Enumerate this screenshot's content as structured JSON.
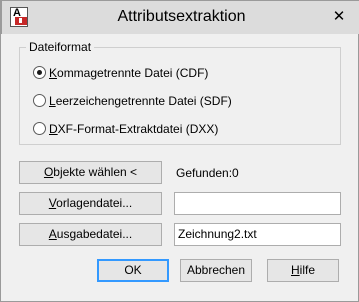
{
  "window": {
    "title": "Attributsextraktion",
    "close_glyph": "✕",
    "icon_letter": "A"
  },
  "dateiformat": {
    "group_label": "Dateiformat",
    "options": [
      {
        "accel": "K",
        "rest": "ommagetrennte Datei (CDF)",
        "selected": true
      },
      {
        "accel": "L",
        "rest": "eerzeichengetrennte Datei (SDF)",
        "selected": false
      },
      {
        "accel": "D",
        "rest": "XF-Format-Extraktdatei (DXX)",
        "selected": false
      }
    ]
  },
  "objects": {
    "button_accel": "O",
    "button_rest": "bjekte wählen <",
    "found_label": "Gefunden:",
    "found_value": "0"
  },
  "vorlage": {
    "button_accel": "V",
    "button_rest": "orlagendatei...",
    "value": ""
  },
  "ausgabe": {
    "button_accel": "A",
    "button_rest": "usgabedatei...",
    "value": "Zeichnung2.txt"
  },
  "footer": {
    "ok_label": "OK",
    "cancel_label": "Abbrechen",
    "help_accel": "H",
    "help_rest": "ilfe"
  }
}
